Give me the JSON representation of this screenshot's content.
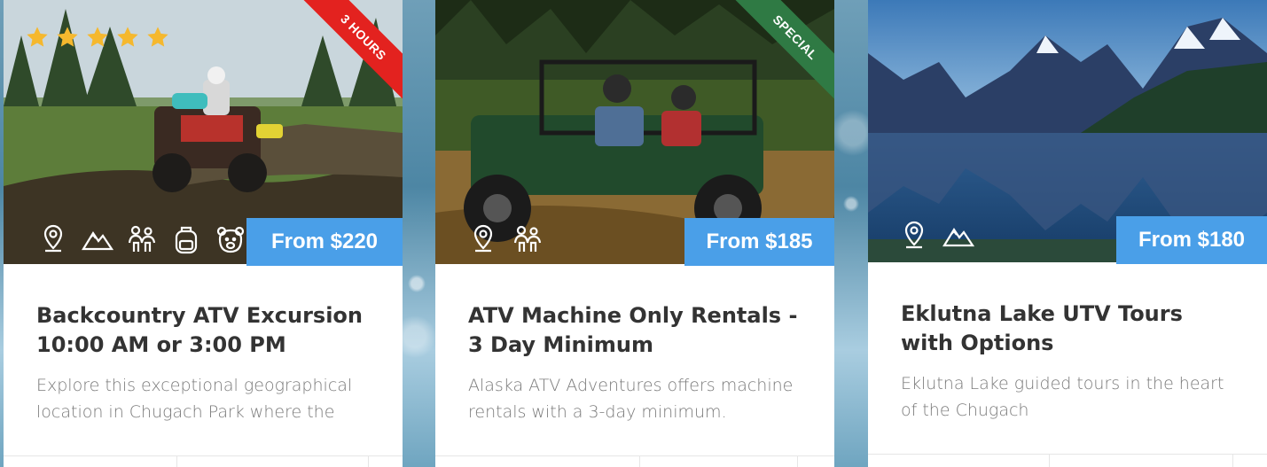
{
  "cards": [
    {
      "ribbon": "3 HOURS",
      "ribbon_color": "#e3221f",
      "rating": 5,
      "price": "From $220",
      "icons": [
        "map-pin-icon",
        "mountain-icon",
        "family-icon",
        "backpack-icon",
        "bear-icon"
      ],
      "title": "Backcountry ATV Excursion 10:00 AM or 3:00 PM",
      "description": "Explore this exceptional geographical location in Chugach Park where the"
    },
    {
      "ribbon": "SPECIAL",
      "ribbon_color": "#2f7a44",
      "price": "From $185",
      "icons": [
        "map-pin-icon",
        "family-icon"
      ],
      "title": "ATV Machine Only Rentals - 3 Day Minimum",
      "description": "Alaska ATV Adventures offers machine rentals with a 3-day minimum."
    },
    {
      "price": "From $180",
      "icons": [
        "map-pin-icon",
        "mountain-icon"
      ],
      "title": "Eklutna Lake UTV Tours with Options",
      "description": "Eklutna Lake guided tours in the heart of the Chugach"
    }
  ],
  "colors": {
    "price_badge": "#4a9fe8",
    "star": "#f5b82e",
    "title_text": "#333333",
    "description_text": "#7a7a7a"
  }
}
